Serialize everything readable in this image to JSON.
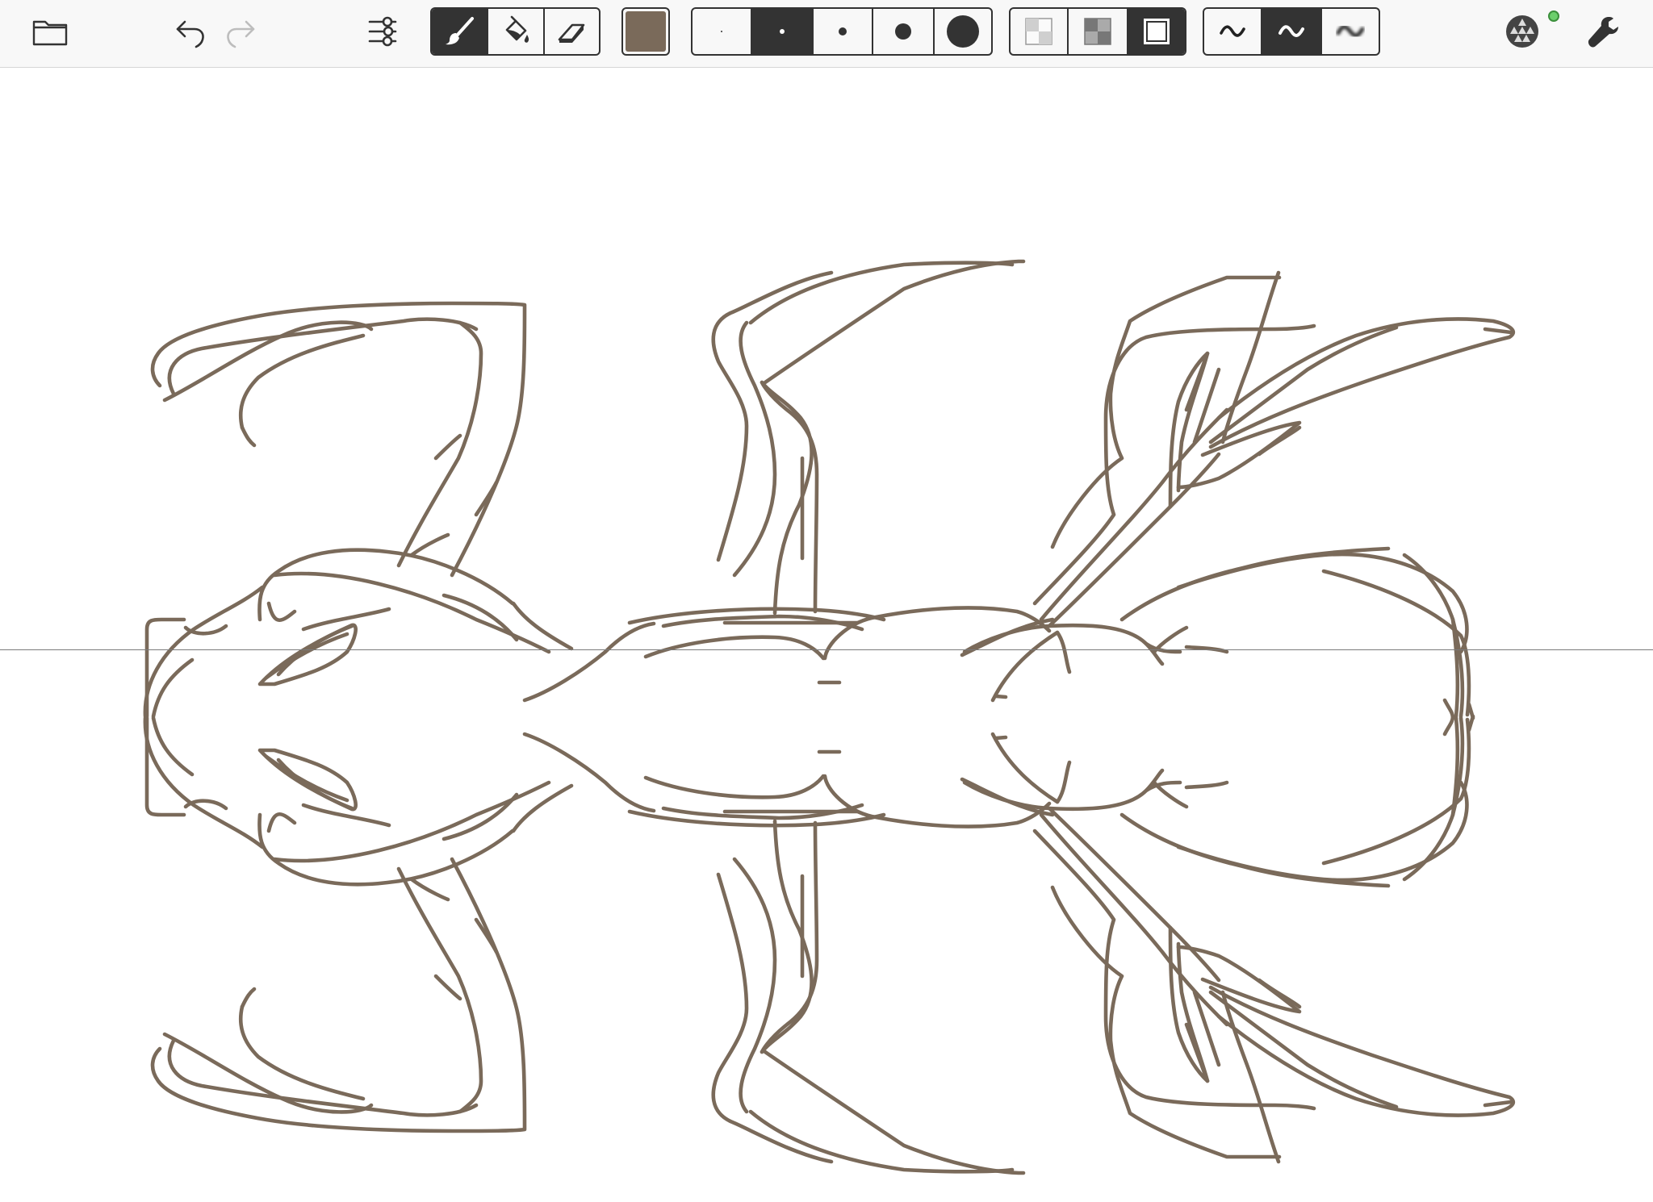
{
  "app": {
    "toolbar": {
      "file_icon": "folder-icon",
      "undo_icon": "undo-icon",
      "redo_icon": "redo-icon",
      "settings_icon": "sliders-icon",
      "tools": [
        {
          "name": "brush",
          "icon": "brush-icon",
          "active": true
        },
        {
          "name": "fill",
          "icon": "paint-bucket-icon",
          "active": false
        },
        {
          "name": "eraser",
          "icon": "eraser-icon",
          "active": false
        }
      ],
      "current_color": "#7a6a5a",
      "brush_sizes": [
        {
          "name": "size-1",
          "active": false
        },
        {
          "name": "size-2",
          "active": true
        },
        {
          "name": "size-3",
          "active": false
        },
        {
          "name": "size-4",
          "active": false
        },
        {
          "name": "size-5",
          "active": false
        }
      ],
      "opacity_options": [
        {
          "name": "opacity-low",
          "icon": "opacity-low-icon",
          "active": false
        },
        {
          "name": "opacity-medium",
          "icon": "opacity-medium-icon",
          "active": false
        },
        {
          "name": "opacity-full",
          "icon": "opacity-full-icon",
          "active": true
        }
      ],
      "stroke_styles": [
        {
          "name": "stroke-thin",
          "icon": "stroke-thin-icon",
          "active": false
        },
        {
          "name": "stroke-smooth",
          "icon": "stroke-smooth-icon",
          "active": true
        },
        {
          "name": "stroke-blur",
          "icon": "stroke-blur-icon",
          "active": false
        }
      ],
      "symmetry_icon": "symmetry-icon",
      "symmetry_status_color": "#6ccf6c",
      "tools_menu_icon": "wrench-icon"
    },
    "canvas": {
      "stroke_color": "#7a6a5a",
      "symmetry": "horizontal-mirror",
      "mirror_line_color": "#7a7a7a"
    }
  }
}
